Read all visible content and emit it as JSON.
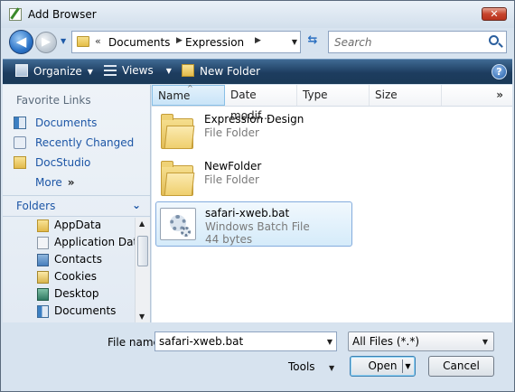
{
  "window": {
    "title": "Add Browser",
    "close_label": "✕"
  },
  "nav": {
    "back_glyph": "◀",
    "forward_glyph": "▶",
    "breadcrumb": [
      "«",
      "Documents",
      "▶",
      "Expression",
      "▶"
    ],
    "search_placeholder": "Search"
  },
  "commands": {
    "organize": "Organize",
    "views": "Views",
    "new_folder": "New Folder",
    "help": "?"
  },
  "favorites": {
    "heading": "Favorite Links",
    "links": [
      "Documents",
      "Recently Changed",
      "DocStudio"
    ],
    "more": "More",
    "more_glyph": "»"
  },
  "folders": {
    "title": "Folders",
    "chevron": "⌄",
    "items": [
      "AppData",
      "Application Data",
      "Contacts",
      "Cookies",
      "Desktop",
      "Documents"
    ]
  },
  "columns": [
    "Name",
    "Date modif...",
    "Type",
    "Size"
  ],
  "columns_more": "»",
  "files": [
    {
      "name": "Expression Design",
      "type": "File Folder"
    },
    {
      "name": "NewFolder",
      "type": "File Folder"
    },
    {
      "name": "safari-xweb.bat",
      "type": "Windows Batch File",
      "size": "44 bytes"
    }
  ],
  "footer": {
    "file_name_label": "File name:",
    "file_name_value": "safari-xweb.bat",
    "filter_value": "All Files (*.*)",
    "tools_label": "Tools",
    "open_label": "Open",
    "cancel_label": "Cancel"
  }
}
